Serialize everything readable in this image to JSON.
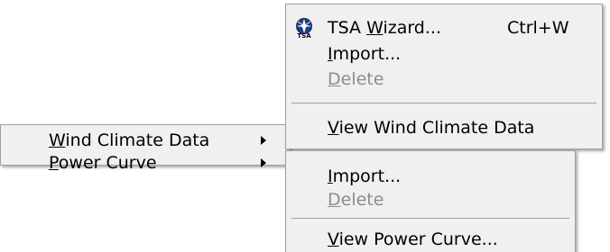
{
  "main_menu": {
    "items": [
      {
        "mnemonic": "W",
        "rest": "ind Climate Data",
        "has_submenu": true,
        "enabled": true
      },
      {
        "mnemonic": "P",
        "rest": "ower Curve",
        "has_submenu": true,
        "enabled": true
      }
    ]
  },
  "wind_submenu": {
    "items": [
      {
        "pre": "TSA ",
        "mnemonic": "W",
        "rest": "izard...",
        "shortcut": "Ctrl+W",
        "icon": "tsa-wizard-icon",
        "enabled": true
      },
      {
        "pre": "",
        "mnemonic": "I",
        "rest": "mport...",
        "enabled": true
      },
      {
        "pre": "",
        "mnemonic": "D",
        "rest": "elete",
        "enabled": false
      },
      {
        "pre": "",
        "mnemonic": "V",
        "rest": "iew Wind Climate Data",
        "enabled": true
      }
    ]
  },
  "power_submenu": {
    "items": [
      {
        "mnemonic": "I",
        "rest": "mport...",
        "enabled": true
      },
      {
        "mnemonic": "D",
        "rest": "elete",
        "enabled": false
      },
      {
        "mnemonic": "V",
        "rest": "iew Power Curve...",
        "enabled": true
      }
    ]
  },
  "colors": {
    "menu_bg": "#f0f0f0",
    "border": "#a0a0a0",
    "disabled_text": "#8d8d8d",
    "text": "#000000"
  }
}
